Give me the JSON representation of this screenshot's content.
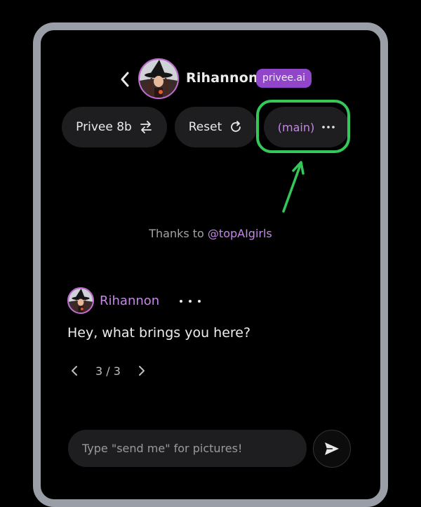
{
  "header": {
    "back_icon": "chevron-left-icon",
    "name": "Rihannon",
    "badge": "privee.ai"
  },
  "controls": {
    "model_label": "Privee 8b",
    "model_icon": "swap-arrows-icon",
    "reset_label": "Reset",
    "reset_icon": "refresh-icon",
    "branch_label": "(main)",
    "branch_icon": "more-horizontal-icon"
  },
  "credit": {
    "prefix": "Thanks to",
    "handle": "@topAIgirls"
  },
  "message": {
    "author": "Rihannon",
    "text": "Hey, what brings you here?",
    "pager": "3 / 3"
  },
  "composer": {
    "placeholder": "Type \"send me\" for pictures!",
    "value": ""
  },
  "colors": {
    "accent": "#c488e6",
    "badge": "#9146c9",
    "annotation": "#34c759",
    "pill_bg": "#1e1e20"
  }
}
